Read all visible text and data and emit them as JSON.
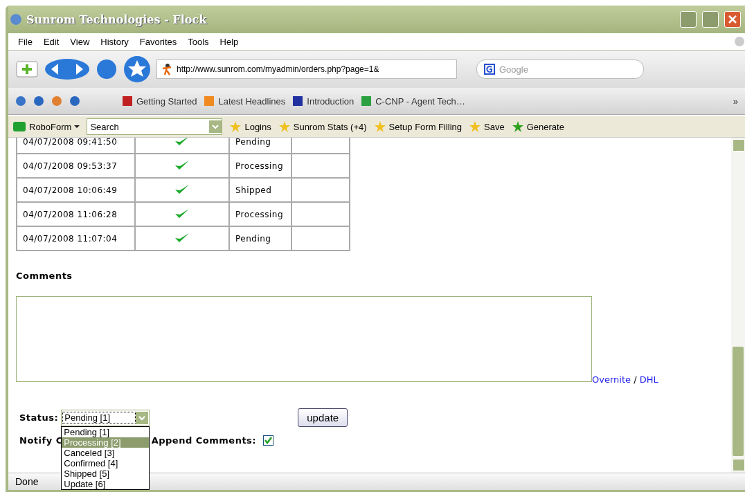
{
  "window": {
    "title": "Sunrom Technologies - Flock"
  },
  "menu": [
    "File",
    "Edit",
    "View",
    "History",
    "Favorites",
    "Tools",
    "Help"
  ],
  "address": {
    "url": "http://www.sunrom.com/myadmin/orders.php?page=1&"
  },
  "web_search": {
    "placeholder": "Google"
  },
  "bookmarks": [
    "Getting Started",
    "Latest Headlines",
    "Introduction",
    "C-CNP - Agent Tech…"
  ],
  "bookmarks_more": "»",
  "roboform": {
    "label": "RoboForm",
    "search": "Search",
    "items": [
      "Logins",
      "Sunrom Stats (+4)",
      "Setup Form Filling",
      "Save",
      "Generate"
    ]
  },
  "history_rows": [
    {
      "date": "04/07/2008 09:41:50",
      "notified": true,
      "status": "Pending"
    },
    {
      "date": "04/07/2008 09:53:37",
      "notified": true,
      "status": "Processing"
    },
    {
      "date": "04/07/2008 10:06:49",
      "notified": true,
      "status": "Shipped"
    },
    {
      "date": "04/07/2008 11:06:28",
      "notified": true,
      "status": "Processing"
    },
    {
      "date": "04/07/2008 11:07:04",
      "notified": true,
      "status": "Pending"
    }
  ],
  "comments": {
    "heading": "Comments",
    "links": [
      "Overnite",
      "DHL"
    ],
    "separator": "/"
  },
  "status_form": {
    "label": "Status:",
    "value": "Pending [1]",
    "options": [
      {
        "label": "Pending [1]",
        "highlighted": false
      },
      {
        "label": "Processing [2]",
        "highlighted": true
      },
      {
        "label": "Canceled [3]",
        "highlighted": false
      },
      {
        "label": "Confirmed [4]",
        "highlighted": false
      },
      {
        "label": "Shipped [5]",
        "highlighted": false
      },
      {
        "label": "Update [6]",
        "highlighted": false
      }
    ],
    "button": "update",
    "notify_label": "Notify C",
    "append_label": "Append Comments:",
    "append_checked": true
  },
  "status_bar": "Done"
}
